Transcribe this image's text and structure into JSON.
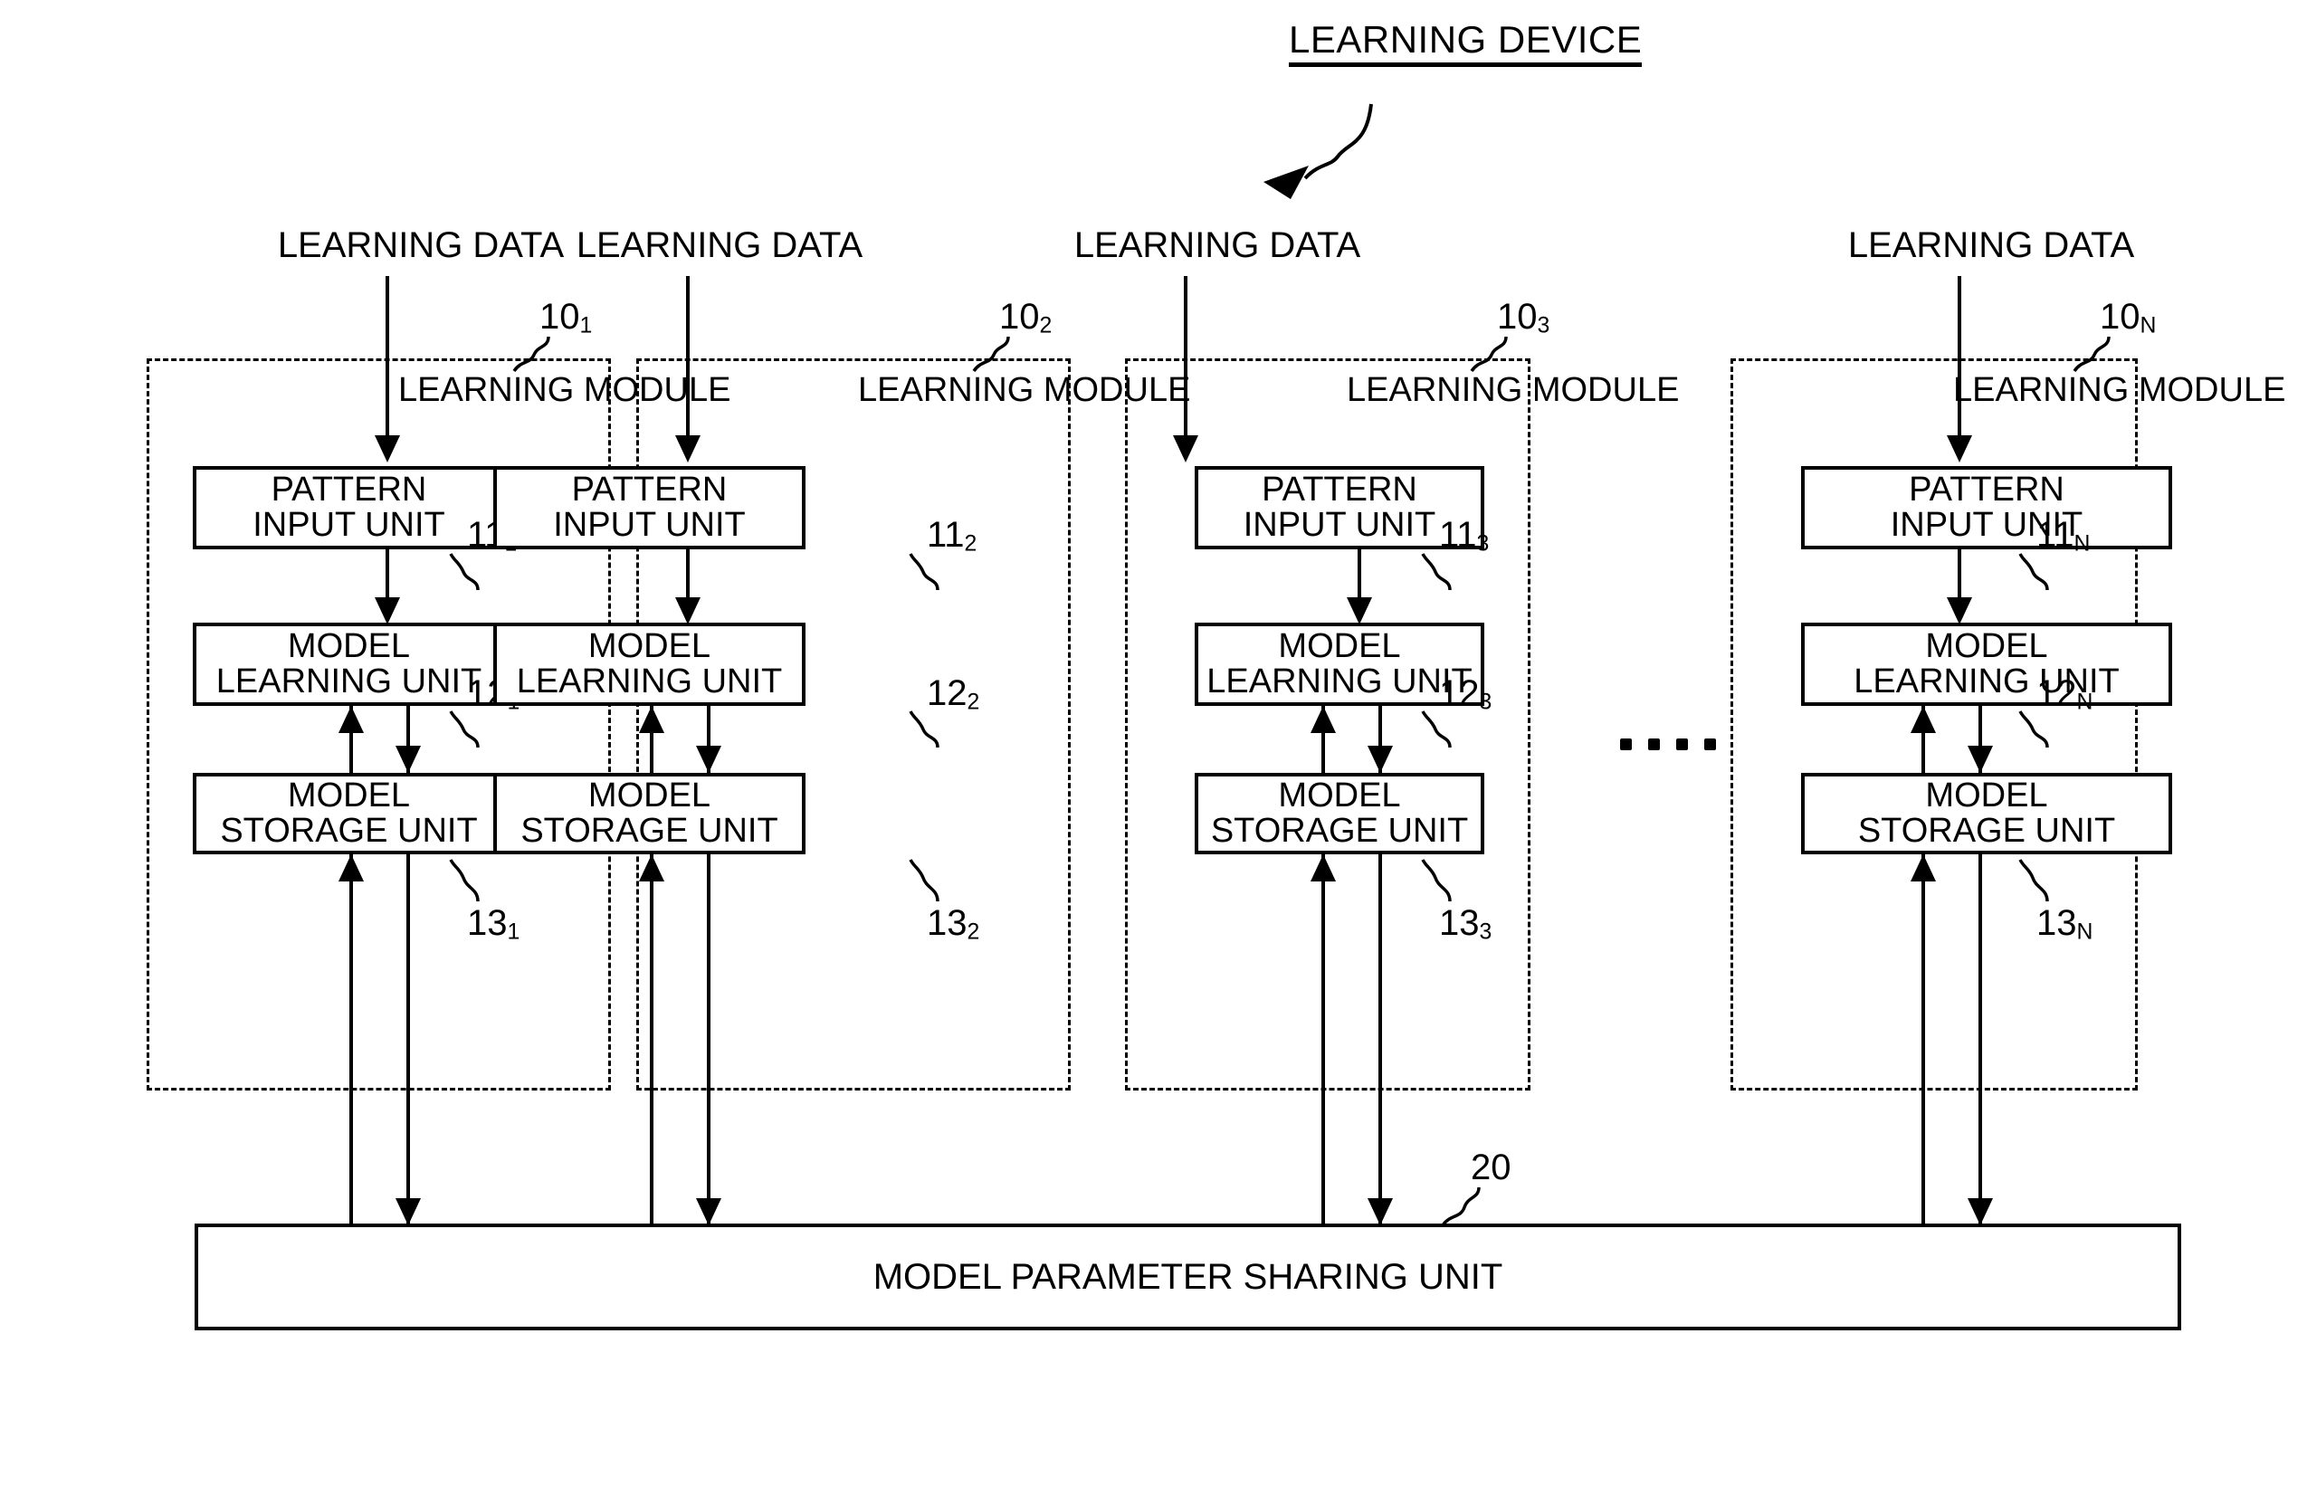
{
  "figure": {
    "title": "LEARNING DEVICE",
    "title_arrow_icon": "curved-arrow-icon",
    "bottom_unit_label": "MODEL PARAMETER SHARING UNIT",
    "bottom_unit_ref": "20",
    "ellipsis": "...."
  },
  "module_caption_line1": "LEARNING",
  "module_caption_line2": "MODULE",
  "unit_labels": {
    "pattern_input_line1": "PATTERN",
    "pattern_input_line2": "INPUT UNIT",
    "model_learning_line1": "MODEL",
    "model_learning_line2": "LEARNING UNIT",
    "model_storage_line1": "MODEL",
    "model_storage_line2": "STORAGE UNIT"
  },
  "modules": [
    {
      "input_label": "LEARNING DATA",
      "module_ref_base": "10",
      "module_ref_sub": "1",
      "pattern_input_ref_base": "11",
      "pattern_input_ref_sub": "1",
      "model_learning_ref_base": "12",
      "model_learning_ref_sub": "1",
      "model_storage_ref_base": "13",
      "model_storage_ref_sub": "1"
    },
    {
      "input_label": "LEARNING DATA",
      "module_ref_base": "10",
      "module_ref_sub": "2",
      "pattern_input_ref_base": "11",
      "pattern_input_ref_sub": "2",
      "model_learning_ref_base": "12",
      "model_learning_ref_sub": "2",
      "model_storage_ref_base": "13",
      "model_storage_ref_sub": "2"
    },
    {
      "input_label": "LEARNING DATA",
      "module_ref_base": "10",
      "module_ref_sub": "3",
      "pattern_input_ref_base": "11",
      "pattern_input_ref_sub": "3",
      "model_learning_ref_base": "12",
      "model_learning_ref_sub": "3",
      "model_storage_ref_base": "13",
      "model_storage_ref_sub": "3"
    },
    {
      "input_label": "LEARNING DATA",
      "module_ref_base": "10",
      "module_ref_sub": "N",
      "pattern_input_ref_base": "11",
      "pattern_input_ref_sub": "N",
      "model_learning_ref_base": "12",
      "model_learning_ref_sub": "N",
      "model_storage_ref_base": "13",
      "model_storage_ref_sub": "N"
    }
  ],
  "colors": {
    "ink": "#000000",
    "paper": "#ffffff"
  }
}
